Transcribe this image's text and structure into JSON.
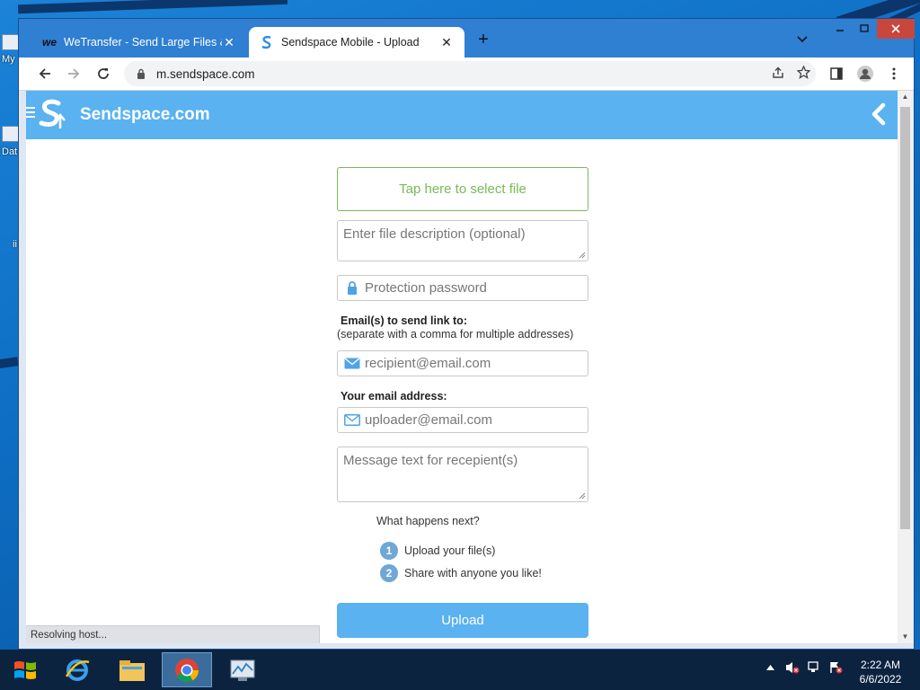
{
  "desktop": {
    "labels": [
      "My",
      "Dat",
      "ii"
    ]
  },
  "browser": {
    "tabs": [
      {
        "favicon": "wetransfer-icon",
        "title": "WeTransfer - Send Large Files &",
        "close": "✕"
      },
      {
        "favicon": "sendspace-icon",
        "title": "Sendspace Mobile - Upload",
        "close": "✕"
      }
    ],
    "new_tab": "+",
    "url": "m.sendspace.com",
    "status": "Resolving host..."
  },
  "site": {
    "name": "Sendspace.com",
    "select_file": "Tap here to select file",
    "description_placeholder": "Enter file description (optional)",
    "password_placeholder": "Protection password",
    "emails_label": "Email(s) to send link to:",
    "emails_hint": "(separate with a comma for multiple addresses)",
    "recipient_placeholder": "recipient@email.com",
    "your_email_label": "Your email address:",
    "uploader_placeholder": "uploader@email.com",
    "message_placeholder": "Message text for recepient(s)",
    "next_title": "What happens next?",
    "steps": [
      {
        "num": "1",
        "text": "Upload your file(s)"
      },
      {
        "num": "2",
        "text": "Share with anyone you like!"
      }
    ],
    "upload_button": "Upload"
  },
  "taskbar": {
    "time": "2:22 AM",
    "date": "6/6/2022"
  },
  "colors": {
    "header_blue": "#5ab2f0",
    "green": "#7ab85a",
    "step_blue": "#6fa7d6"
  }
}
